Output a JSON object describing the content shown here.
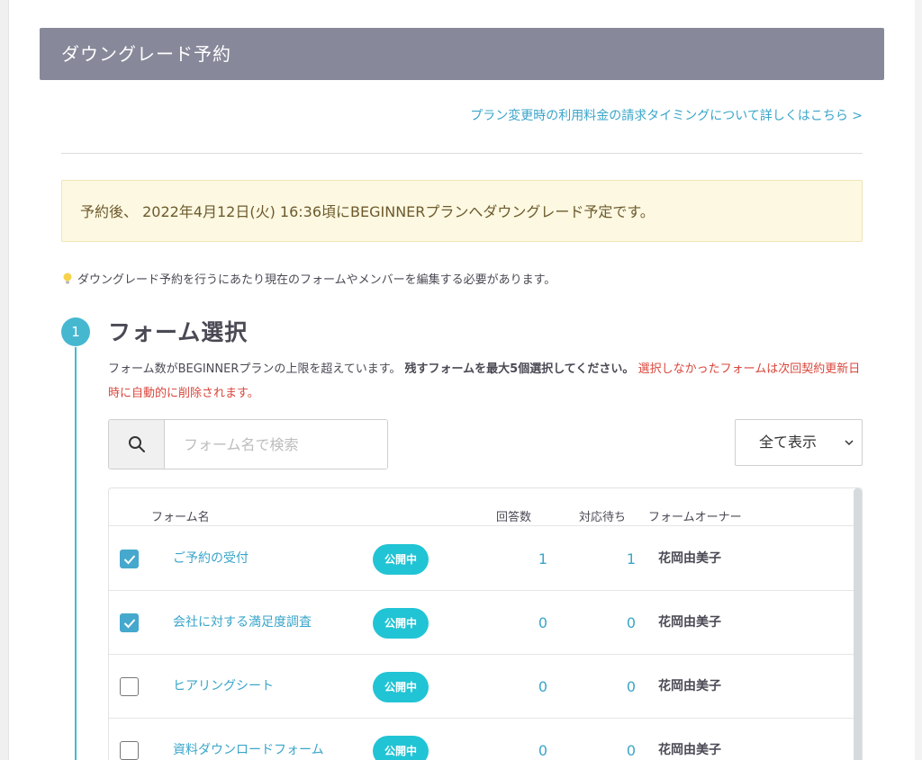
{
  "header": {
    "title": "ダウングレード予約"
  },
  "billing_link": "プラン変更時の利用料金の請求タイミングについて詳しくはこちら >",
  "notice": "予約後、 2022年4月12日(火) 16:36頃にBEGINNERプランへダウングレード予定です。",
  "hint": "ダウングレード予約を行うにあたり現在のフォームやメンバーを編集する必要があります。",
  "step": {
    "number": "1",
    "title": "フォーム選択",
    "desc_normal": "フォーム数がBEGINNERプランの上限を超えています。",
    "desc_strong": "残すフォームを最大5個選択してください。",
    "desc_warn": "選択しなかったフォームは次回契約更新日時に自動的に削除されます。"
  },
  "search": {
    "placeholder": "フォーム名で検索",
    "icon": "search-icon"
  },
  "filter": {
    "label": "全て表示",
    "icon": "chevron-down-icon"
  },
  "table": {
    "columns": {
      "name": "フォーム名",
      "answers": "回答数",
      "pending": "対応待ち",
      "owner": "フォームオーナー"
    },
    "rows": [
      {
        "checked": true,
        "name": "ご予約の受付",
        "status": "公開中",
        "answers": "1",
        "pending": "1",
        "owner": "花岡由美子"
      },
      {
        "checked": true,
        "name": "会社に対する満足度調査",
        "status": "公開中",
        "answers": "0",
        "pending": "0",
        "owner": "花岡由美子"
      },
      {
        "checked": false,
        "name": "ヒアリングシート",
        "status": "公開中",
        "answers": "0",
        "pending": "0",
        "owner": "花岡由美子"
      },
      {
        "checked": false,
        "name": "資料ダウンロードフォーム",
        "status": "公開中",
        "answers": "0",
        "pending": "0",
        "owner": "花岡由美子"
      }
    ]
  },
  "colors": {
    "header_bg": "#878899",
    "accent": "#45b8d0",
    "link": "#3aa5c9",
    "status_bg": "#21c4d4",
    "warn": "#d9463b",
    "notice_bg": "#fcf8e1"
  }
}
